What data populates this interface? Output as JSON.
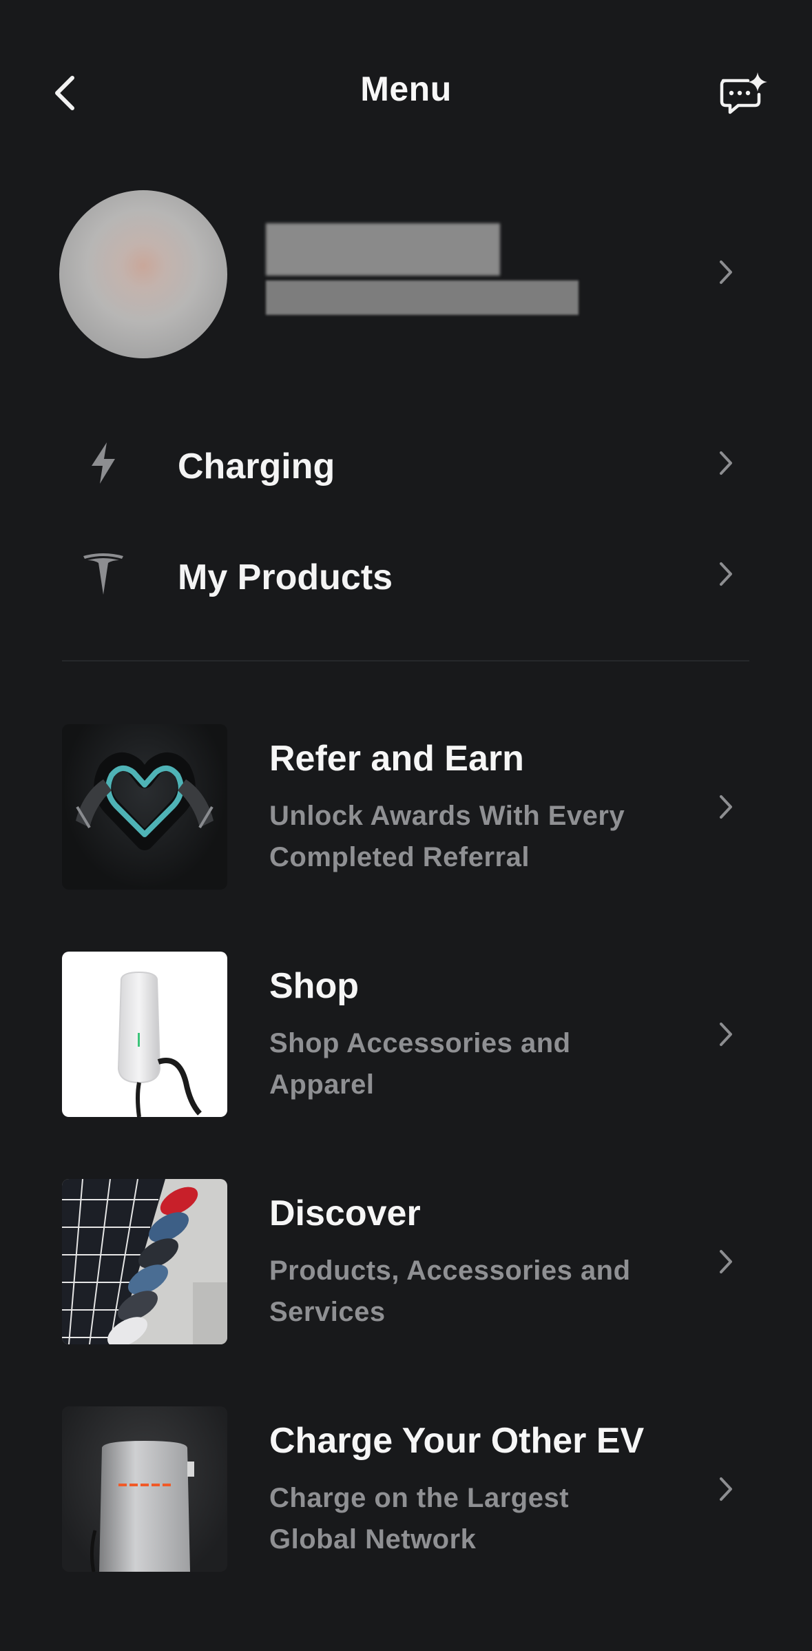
{
  "header": {
    "title": "Menu",
    "back_icon": "chevron-left-icon",
    "chat_icon": "ai-chat-icon"
  },
  "profile": {
    "name": "",
    "email": ""
  },
  "quick_links": [
    {
      "label": "Charging",
      "icon": "lightning-bolt-icon"
    },
    {
      "label": "My Products",
      "icon": "tesla-logo-icon"
    }
  ],
  "features": [
    {
      "title": "Refer and Earn",
      "subtitle": "Unlock Awards With Every Completed Referral"
    },
    {
      "title": "Shop",
      "subtitle": "Shop Accessories and Apparel"
    },
    {
      "title": "Discover",
      "subtitle": "Products, Accessories and Services"
    },
    {
      "title": "Charge Your Other EV",
      "subtitle": "Charge on the Largest Global Network"
    }
  ],
  "colors": {
    "background": "#18191b",
    "primary_text": "#f4f4f4",
    "secondary_text": "#8f9093",
    "chevron": "#8d8e91"
  }
}
